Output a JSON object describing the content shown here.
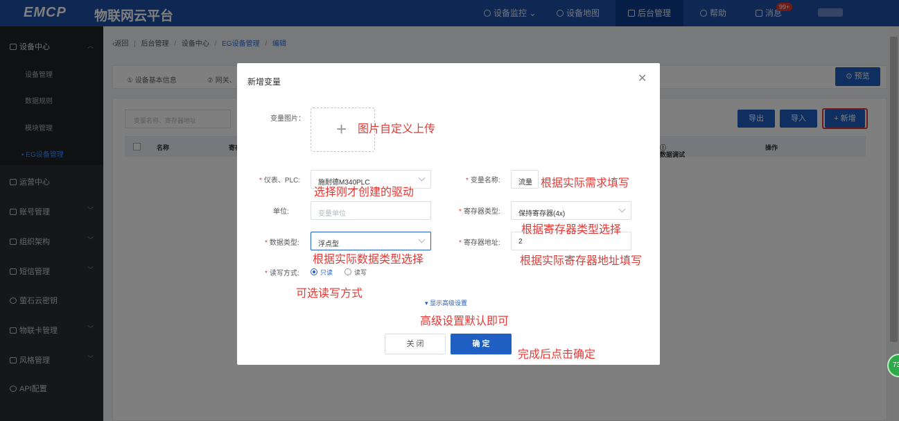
{
  "header": {
    "logo": "EMCP",
    "subtitle": "物联网云平台",
    "nav": [
      "设备监控",
      "设备地图",
      "后台管理",
      "帮助",
      "消息"
    ],
    "badge": "99+"
  },
  "sidebar": {
    "device_center": "设备中心",
    "items": [
      "设备管理",
      "数据规则",
      "模块管理",
      "EG设备管理"
    ],
    "groups": [
      "运营中心",
      "账号管理",
      "组织架构",
      "短信管理",
      "萤石云密钥",
      "物联卡管理",
      "风格管理",
      "API配置"
    ]
  },
  "breadcrumb": {
    "back": "返回",
    "items": [
      "后台管理",
      "设备中心",
      "EG设备管理",
      "编辑"
    ]
  },
  "tabs": [
    "① 设备基本信息",
    "② 网关、"
  ],
  "toolbar": {
    "preview": "预览",
    "search_placeholder": "变量名称、寄存器地址",
    "export": "导出",
    "import": "导入",
    "add": "+ 新增"
  },
  "table_headers": [
    "名称",
    "寄存",
    "数据调试",
    "操作"
  ],
  "float_ball": "73",
  "dialog": {
    "title": "新增变量",
    "image_label": "变量图片：",
    "plc_label": "仪表、PLC:",
    "plc_value": "施耐德M340PLC",
    "varname_label": "变量名称:",
    "varname_value": "流量",
    "unit_label": "单位:",
    "unit_placeholder": "变量单位",
    "regtype_label": "寄存器类型:",
    "regtype_value": "保持寄存器(4x)",
    "datatype_label": "数据类型:",
    "datatype_value": "浮点型",
    "regaddr_label": "寄存器地址:",
    "regaddr_value": "2",
    "rw_label": "读写方式:",
    "rw_readonly": "只读",
    "rw_readwrite": "读写",
    "advanced": "显示高级设置",
    "close": "关 闭",
    "ok": "确 定"
  },
  "annotations": {
    "upload": "图片自定义上传",
    "plc": "选择刚才创建的驱动",
    "varname": "根据实际需求填写",
    "regtype": "根据寄存器类型选择",
    "datatype": "根据实际数据类型选择",
    "regaddr": "根据实际寄存器地址填写",
    "rw": "可选读写方式",
    "advanced": "高级设置默认即可",
    "confirm": "完成后点击确定"
  }
}
